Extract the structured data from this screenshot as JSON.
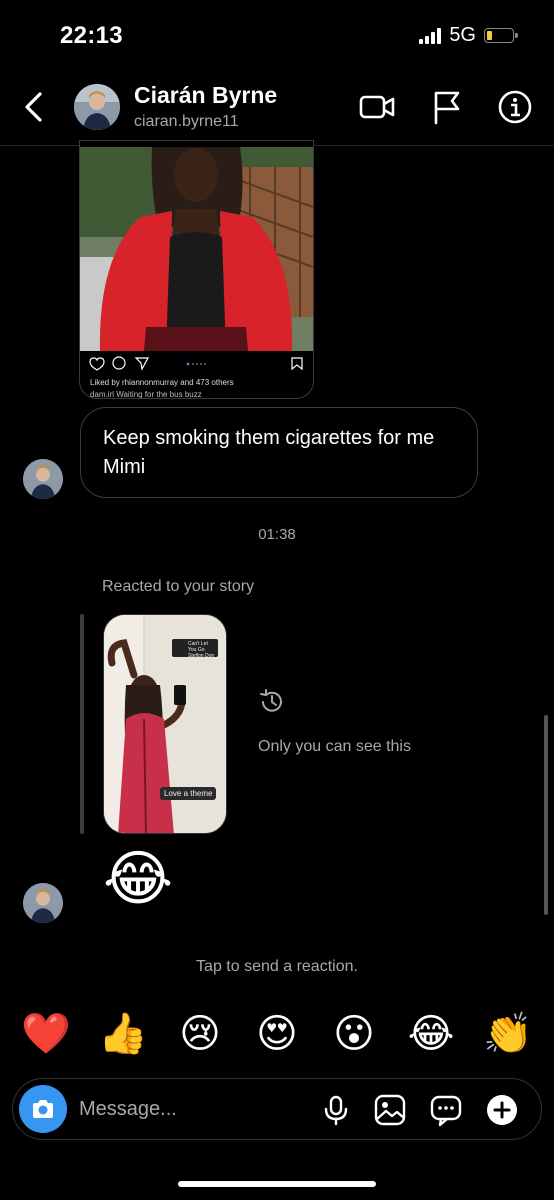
{
  "status_bar": {
    "time": "22:13",
    "network": "5G",
    "battery_level": 0.2
  },
  "header": {
    "name": "Ciarán Byrne",
    "username": "ciaran.byrne11",
    "icons": [
      "back-chevron-icon",
      "video-call-icon",
      "flag-icon",
      "info-icon"
    ]
  },
  "shared_post": {
    "liked_by": "Liked by rhiannonmurray and 473 others",
    "caption": "dam.irl Waiting for the bus buzz"
  },
  "messages": {
    "text_1": "Keep smoking them cigarettes for me Mimi",
    "timestamp": "01:38",
    "reacted_label": "Reacted to your story",
    "only_you": "Only you can see this",
    "big_reaction": "😂"
  },
  "story": {
    "sticker_title": "Can't Let You Go",
    "sticker_artist": "Steflon Don",
    "caption": "Love a theme"
  },
  "reaction_bar": {
    "hint": "Tap to send a reaction.",
    "emojis": [
      "❤️",
      "👍",
      "😢",
      "😍",
      "😮",
      "😂",
      "👏"
    ]
  },
  "composer": {
    "placeholder": "Message..."
  },
  "colors": {
    "accent": "#3797f0",
    "background": "#000000",
    "muted_text": "#a8a8a8"
  }
}
